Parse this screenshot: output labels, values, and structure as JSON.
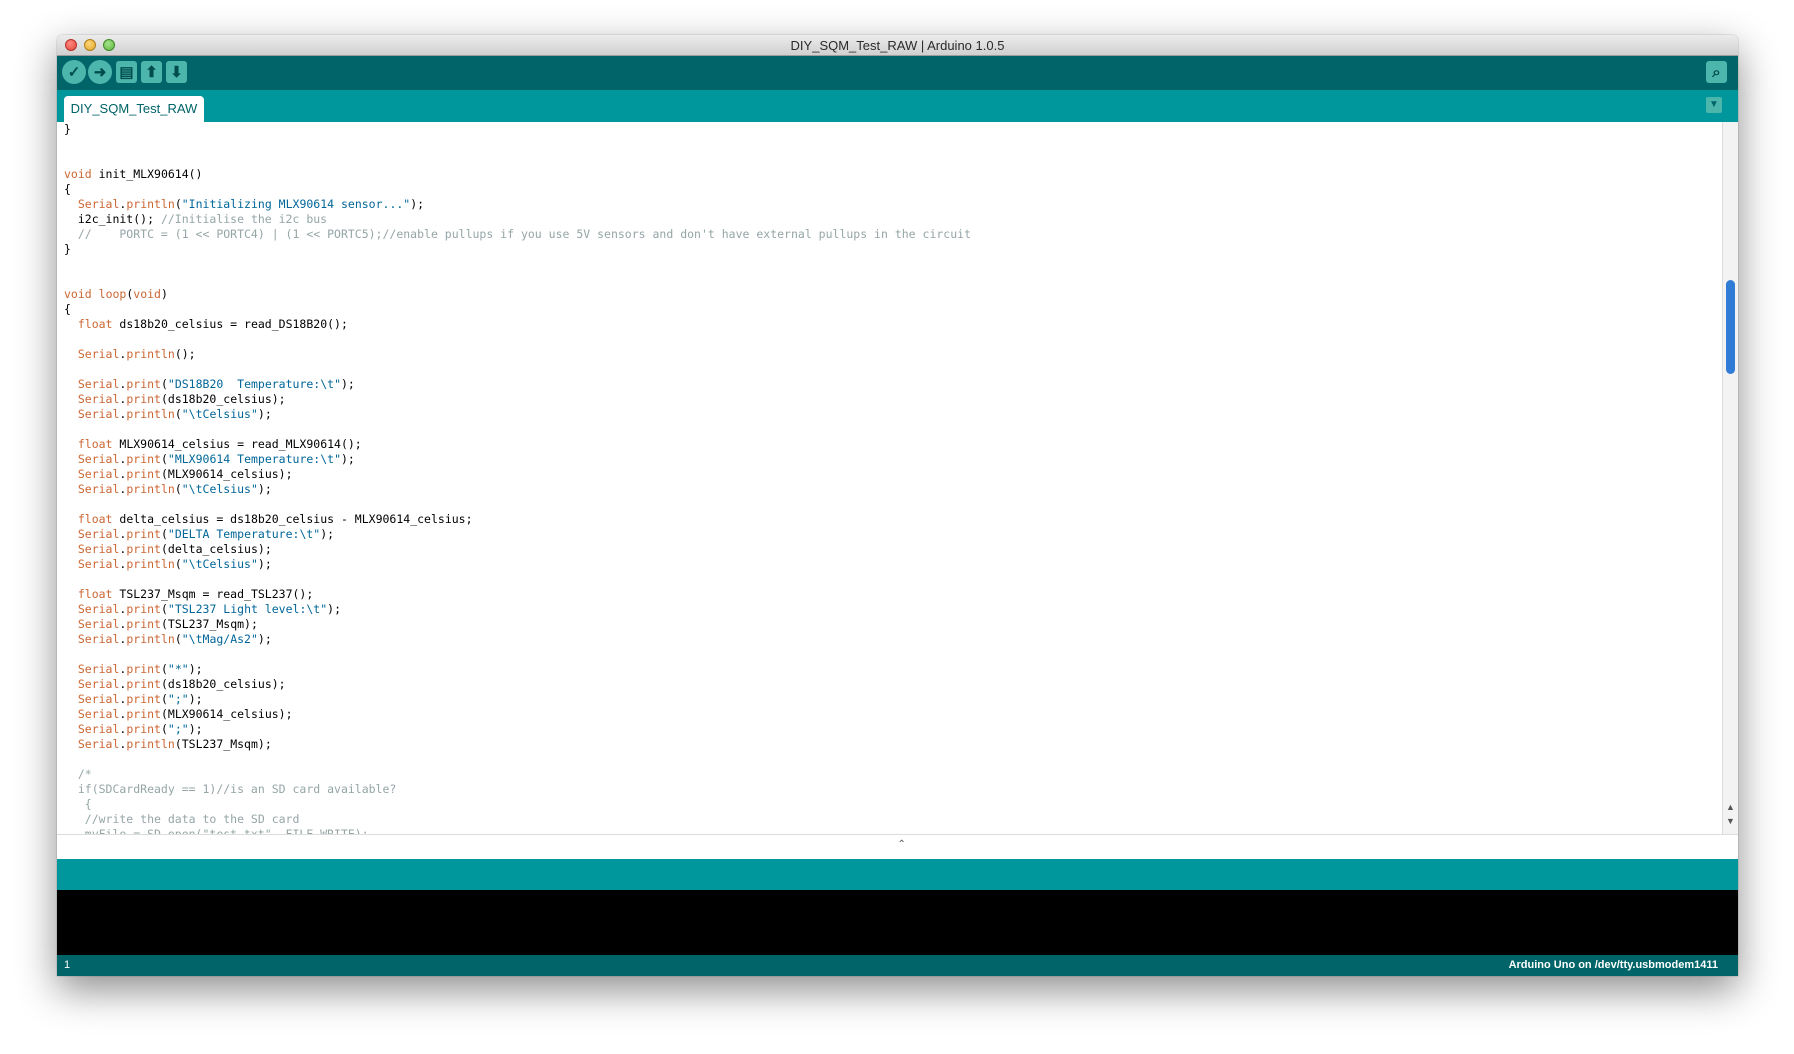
{
  "window": {
    "title": "DIY_SQM_Test_RAW | Arduino 1.0.5"
  },
  "toolbar": {
    "verify_icon": "checkmark-icon",
    "upload_icon": "arrow-right-icon",
    "new_icon": "document-icon",
    "open_icon": "arrow-up-icon",
    "save_icon": "arrow-down-icon",
    "serial_monitor_icon": "magnifier-icon"
  },
  "tab": {
    "label": "DIY_SQM_Test_RAW"
  },
  "footer": {
    "line_number": "1",
    "board": "Arduino Uno on /dev/tty.usbmodem1411"
  },
  "colors": {
    "toolbar": "#006468",
    "tabbar": "#00979c",
    "keyword": "#cc6633",
    "string": "#006699",
    "comment": "#95a5a6"
  },
  "code_lines": [
    [
      {
        "t": "}"
      }
    ],
    [],
    [],
    [
      {
        "t": "void",
        "c": "kw"
      },
      {
        "t": " init_MLX90614()"
      }
    ],
    [
      {
        "t": "{"
      }
    ],
    [
      {
        "t": "  "
      },
      {
        "t": "Serial",
        "c": "fn"
      },
      {
        "t": "."
      },
      {
        "t": "println",
        "c": "fn"
      },
      {
        "t": "("
      },
      {
        "t": "\"Initializing MLX90614 sensor...\"",
        "c": "str"
      },
      {
        "t": ");"
      }
    ],
    [
      {
        "t": "  i2c_init(); "
      },
      {
        "t": "//Initialise the i2c bus",
        "c": "cm"
      }
    ],
    [
      {
        "t": "  //    PORTC = (1 << PORTC4) | (1 << PORTC5);//enable pullups if you use 5V sensors and don't have external pullups in the circuit",
        "c": "cm"
      }
    ],
    [
      {
        "t": "}"
      }
    ],
    [],
    [],
    [
      {
        "t": "void",
        "c": "kw"
      },
      {
        "t": " "
      },
      {
        "t": "loop",
        "c": "kw"
      },
      {
        "t": "("
      },
      {
        "t": "void",
        "c": "kw"
      },
      {
        "t": ")"
      }
    ],
    [
      {
        "t": "{"
      }
    ],
    [
      {
        "t": "  "
      },
      {
        "t": "float",
        "c": "kw"
      },
      {
        "t": " ds18b20_celsius = read_DS18B20();"
      }
    ],
    [],
    [
      {
        "t": "  "
      },
      {
        "t": "Serial",
        "c": "fn"
      },
      {
        "t": "."
      },
      {
        "t": "println",
        "c": "fn"
      },
      {
        "t": "();"
      }
    ],
    [],
    [
      {
        "t": "  "
      },
      {
        "t": "Serial",
        "c": "fn"
      },
      {
        "t": "."
      },
      {
        "t": "print",
        "c": "fn"
      },
      {
        "t": "("
      },
      {
        "t": "\"DS18B20  Temperature:\\t\"",
        "c": "str"
      },
      {
        "t": ");"
      }
    ],
    [
      {
        "t": "  "
      },
      {
        "t": "Serial",
        "c": "fn"
      },
      {
        "t": "."
      },
      {
        "t": "print",
        "c": "fn"
      },
      {
        "t": "(ds18b20_celsius);"
      }
    ],
    [
      {
        "t": "  "
      },
      {
        "t": "Serial",
        "c": "fn"
      },
      {
        "t": "."
      },
      {
        "t": "println",
        "c": "fn"
      },
      {
        "t": "("
      },
      {
        "t": "\"\\tCelsius\"",
        "c": "str"
      },
      {
        "t": ");"
      }
    ],
    [],
    [
      {
        "t": "  "
      },
      {
        "t": "float",
        "c": "kw"
      },
      {
        "t": " MLX90614_celsius = read_MLX90614();"
      }
    ],
    [
      {
        "t": "  "
      },
      {
        "t": "Serial",
        "c": "fn"
      },
      {
        "t": "."
      },
      {
        "t": "print",
        "c": "fn"
      },
      {
        "t": "("
      },
      {
        "t": "\"MLX90614 Temperature:\\t\"",
        "c": "str"
      },
      {
        "t": ");"
      }
    ],
    [
      {
        "t": "  "
      },
      {
        "t": "Serial",
        "c": "fn"
      },
      {
        "t": "."
      },
      {
        "t": "print",
        "c": "fn"
      },
      {
        "t": "(MLX90614_celsius);"
      }
    ],
    [
      {
        "t": "  "
      },
      {
        "t": "Serial",
        "c": "fn"
      },
      {
        "t": "."
      },
      {
        "t": "println",
        "c": "fn"
      },
      {
        "t": "("
      },
      {
        "t": "\"\\tCelsius\"",
        "c": "str"
      },
      {
        "t": ");"
      }
    ],
    [],
    [
      {
        "t": "  "
      },
      {
        "t": "float",
        "c": "kw"
      },
      {
        "t": " delta_celsius = ds18b20_celsius - MLX90614_celsius;"
      }
    ],
    [
      {
        "t": "  "
      },
      {
        "t": "Serial",
        "c": "fn"
      },
      {
        "t": "."
      },
      {
        "t": "print",
        "c": "fn"
      },
      {
        "t": "("
      },
      {
        "t": "\"DELTA Temperature:\\t\"",
        "c": "str"
      },
      {
        "t": ");"
      }
    ],
    [
      {
        "t": "  "
      },
      {
        "t": "Serial",
        "c": "fn"
      },
      {
        "t": "."
      },
      {
        "t": "print",
        "c": "fn"
      },
      {
        "t": "(delta_celsius);"
      }
    ],
    [
      {
        "t": "  "
      },
      {
        "t": "Serial",
        "c": "fn"
      },
      {
        "t": "."
      },
      {
        "t": "println",
        "c": "fn"
      },
      {
        "t": "("
      },
      {
        "t": "\"\\tCelsius\"",
        "c": "str"
      },
      {
        "t": ");"
      }
    ],
    [],
    [
      {
        "t": "  "
      },
      {
        "t": "float",
        "c": "kw"
      },
      {
        "t": " TSL237_Msqm = read_TSL237();"
      }
    ],
    [
      {
        "t": "  "
      },
      {
        "t": "Serial",
        "c": "fn"
      },
      {
        "t": "."
      },
      {
        "t": "print",
        "c": "fn"
      },
      {
        "t": "("
      },
      {
        "t": "\"TSL237 Light level:\\t\"",
        "c": "str"
      },
      {
        "t": ");"
      }
    ],
    [
      {
        "t": "  "
      },
      {
        "t": "Serial",
        "c": "fn"
      },
      {
        "t": "."
      },
      {
        "t": "print",
        "c": "fn"
      },
      {
        "t": "(TSL237_Msqm);"
      }
    ],
    [
      {
        "t": "  "
      },
      {
        "t": "Serial",
        "c": "fn"
      },
      {
        "t": "."
      },
      {
        "t": "println",
        "c": "fn"
      },
      {
        "t": "("
      },
      {
        "t": "\"\\tMag/As2\"",
        "c": "str"
      },
      {
        "t": ");"
      }
    ],
    [],
    [
      {
        "t": "  "
      },
      {
        "t": "Serial",
        "c": "fn"
      },
      {
        "t": "."
      },
      {
        "t": "print",
        "c": "fn"
      },
      {
        "t": "("
      },
      {
        "t": "\"*\"",
        "c": "str"
      },
      {
        "t": ");"
      }
    ],
    [
      {
        "t": "  "
      },
      {
        "t": "Serial",
        "c": "fn"
      },
      {
        "t": "."
      },
      {
        "t": "print",
        "c": "fn"
      },
      {
        "t": "(ds18b20_celsius);"
      }
    ],
    [
      {
        "t": "  "
      },
      {
        "t": "Serial",
        "c": "fn"
      },
      {
        "t": "."
      },
      {
        "t": "print",
        "c": "fn"
      },
      {
        "t": "("
      },
      {
        "t": "\";\"",
        "c": "str"
      },
      {
        "t": ");"
      }
    ],
    [
      {
        "t": "  "
      },
      {
        "t": "Serial",
        "c": "fn"
      },
      {
        "t": "."
      },
      {
        "t": "print",
        "c": "fn"
      },
      {
        "t": "(MLX90614_celsius);"
      }
    ],
    [
      {
        "t": "  "
      },
      {
        "t": "Serial",
        "c": "fn"
      },
      {
        "t": "."
      },
      {
        "t": "print",
        "c": "fn"
      },
      {
        "t": "("
      },
      {
        "t": "\";\"",
        "c": "str"
      },
      {
        "t": ");"
      }
    ],
    [
      {
        "t": "  "
      },
      {
        "t": "Serial",
        "c": "fn"
      },
      {
        "t": "."
      },
      {
        "t": "println",
        "c": "fn"
      },
      {
        "t": "(TSL237_Msqm);"
      }
    ],
    [],
    [
      {
        "t": "  /*",
        "c": "cm"
      }
    ],
    [
      {
        "t": "  if(SDCardReady == 1)//is an SD card available?",
        "c": "cm"
      }
    ],
    [
      {
        "t": "   {",
        "c": "cm"
      }
    ],
    [
      {
        "t": "   //write the data to the SD card",
        "c": "cm"
      }
    ],
    [
      {
        "t": "   myFile = SD.open(\"test.txt\", FILE_WRITE);",
        "c": "cm"
      }
    ]
  ]
}
